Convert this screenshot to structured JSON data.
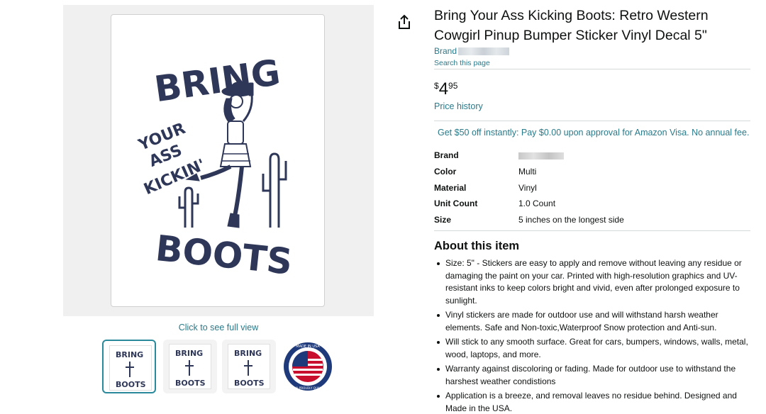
{
  "gallery": {
    "see_full_view": "Click to see full view",
    "sticker_text": {
      "top": "BRING",
      "middle_1": "YOUR",
      "middle_2": "ASS",
      "middle_3": "KICKIN'",
      "bottom": "BOOTS"
    },
    "thumbnails": [
      {
        "label": "BRING",
        "label2": "BOOTS",
        "selected": true
      },
      {
        "label": "BRING",
        "label2": "BOOTS",
        "selected": false
      },
      {
        "label": "BRING",
        "label2": "BOOTS",
        "selected": false
      },
      {
        "label": "MADE IN USA",
        "label2": "100% PROUDLY QUALITY",
        "selected": false
      }
    ]
  },
  "product": {
    "title": "Bring Your Ass Kicking Boots: Retro Western Cowgirl Pinup Bumper Sticker Vinyl Decal 5\"",
    "brand_prefix": "Brand",
    "search_this_page": "Search this page",
    "price": {
      "currency": "$",
      "whole": "4",
      "fraction": "95"
    },
    "price_history": "Price history",
    "promo": "Get $50 off instantly: Pay $0.00 upon approval for Amazon Visa. No annual fee."
  },
  "specs": [
    {
      "key": "Brand",
      "value": ""
    },
    {
      "key": "Color",
      "value": "Multi"
    },
    {
      "key": "Material",
      "value": "Vinyl"
    },
    {
      "key": "Unit Count",
      "value": "1.0 Count"
    },
    {
      "key": "Size",
      "value": "5 inches on the longest side"
    }
  ],
  "about": {
    "title": "About this item",
    "bullets": [
      "Size: 5\" - Stickers are easy to apply and remove without leaving any residue or damaging the paint on your car. Printed with high-resolution graphics and UV-resistant inks to keep colors bright and vivid, even after prolonged exposure to sunlight.",
      "Vinyl stickers are made for outdoor use and will withstand harsh weather elements. Safe and Non-toxic,Waterproof Snow protection and Anti-sun.",
      "Will stick to any smooth surface. Great for cars, bumpers, windows, walls, metal, wood, laptops, and more.",
      "Warranty against discoloring or fading. Made for outdoor use to withstand the harshest weather condistions",
      "Application is a breeze, and removal leaves no residue behind. Designed and Made in the USA."
    ]
  },
  "colors": {
    "link": "#2a7a8a",
    "ink": "#2e3758",
    "flag_red": "#c8102e",
    "flag_blue": "#1f3a7a"
  }
}
